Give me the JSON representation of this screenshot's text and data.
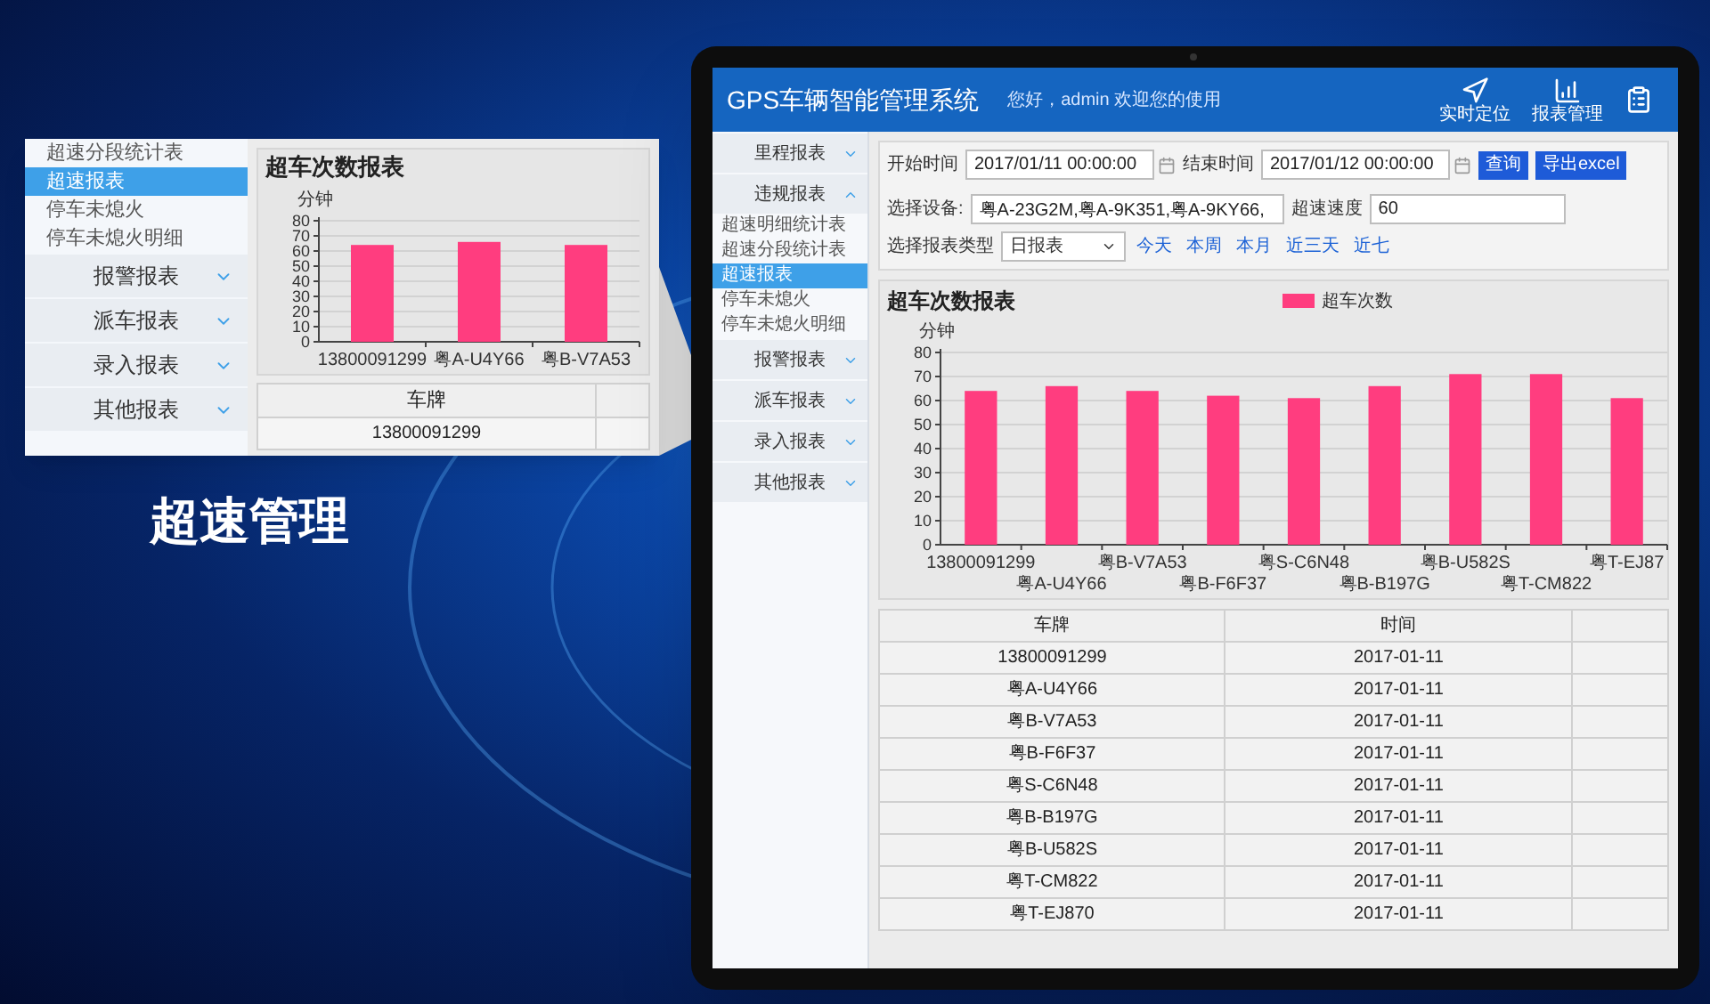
{
  "callout": {
    "sidebar_items": [
      {
        "label": "超速分段统计表",
        "selected": false
      },
      {
        "label": "超速报表",
        "selected": true
      },
      {
        "label": "停车未熄火",
        "selected": false
      },
      {
        "label": "停车未熄火明细",
        "selected": false
      }
    ],
    "sidebar_groups": [
      {
        "label": "报警报表",
        "expanded": false
      },
      {
        "label": "派车报表",
        "expanded": false
      },
      {
        "label": "录入报表",
        "expanded": false
      },
      {
        "label": "其他报表",
        "expanded": false
      }
    ],
    "chart_title": "超车次数报表",
    "chart_data": {
      "type": "bar",
      "grid": true,
      "ylabel": "分钟",
      "categories": [
        "13800091299",
        "粤A-U4Y66",
        "粤B-V7A53"
      ],
      "ylim": [
        0,
        80
      ],
      "yticks": [
        0,
        10,
        20,
        30,
        40,
        50,
        60,
        70,
        80
      ],
      "series": [
        {
          "color": "#ff3d7f",
          "values": [
            64,
            66,
            64
          ]
        }
      ]
    },
    "table": {
      "columns": [
        "车牌"
      ],
      "rows": [
        [
          "13800091299"
        ]
      ]
    }
  },
  "caption": "超速管理",
  "app": {
    "title": "GPS车辆智能管理系统",
    "greeting": "您好，admin 欢迎您的使用",
    "toolbar": [
      {
        "kind": "locate",
        "label": "实时定位"
      },
      {
        "kind": "reports",
        "label": "报表管理"
      },
      {
        "kind": "document"
      }
    ],
    "sidebar": [
      {
        "label": "里程报表",
        "expanded": false
      },
      {
        "label": "违规报表",
        "expanded": true,
        "children": [
          {
            "label": "超速明细统计表",
            "selected": false
          },
          {
            "label": "超速分段统计表",
            "selected": false
          },
          {
            "label": "超速报表",
            "selected": true
          },
          {
            "label": "停车未熄火",
            "selected": false
          },
          {
            "label": "停车未熄火明细",
            "selected": false
          }
        ]
      },
      {
        "label": "报警报表",
        "expanded": false
      },
      {
        "label": "派车报表",
        "expanded": false
      },
      {
        "label": "录入报表",
        "expanded": false
      },
      {
        "label": "其他报表",
        "expanded": false
      }
    ],
    "filters": {
      "start_label": "开始时间",
      "start_value": "2017/01/11 00:00:00",
      "end_label": "结束时间",
      "end_value": "2017/01/12 00:00:00",
      "query_button": "查询",
      "export_button": "导出excel",
      "device_label": "选择设备:",
      "device_value": "粤A-23G2M,粤A-9K351,粤A-9KY66,",
      "speed_label": "超速速度",
      "speed_value": "60",
      "report_type_label": "选择报表类型",
      "report_type_value": "日报表"
    },
    "quick_ranges": [
      "今天",
      "本周",
      "本月",
      "近三天",
      "近七"
    ],
    "chart_title": "超车次数报表",
    "chart_data": {
      "type": "bar",
      "grid": true,
      "ylabel": "分钟",
      "categories": [
        "13800091299",
        "粤A-U4Y66",
        "粤B-V7A53",
        "粤B-F6F37",
        "粤S-C6N48",
        "粤B-B197G",
        "粤B-U582S",
        "粤T-CM822",
        "粤T-EJ87"
      ],
      "ylim": [
        0,
        80
      ],
      "yticks": [
        0,
        10,
        20,
        30,
        40,
        50,
        60,
        70,
        80
      ],
      "series": [
        {
          "name": "超车次数",
          "color": "#ff3d7f",
          "values": [
            64,
            66,
            64,
            62,
            61,
            66,
            71,
            71,
            61
          ]
        }
      ]
    },
    "table": {
      "columns": [
        "车牌",
        "时间"
      ],
      "rows": [
        [
          "13800091299",
          "2017-01-11"
        ],
        [
          "粤A-U4Y66",
          "2017-01-11"
        ],
        [
          "粤B-V7A53",
          "2017-01-11"
        ],
        [
          "粤B-F6F37",
          "2017-01-11"
        ],
        [
          "粤S-C6N48",
          "2017-01-11"
        ],
        [
          "粤B-B197G",
          "2017-01-11"
        ],
        [
          "粤B-U582S",
          "2017-01-11"
        ],
        [
          "粤T-CM822",
          "2017-01-11"
        ],
        [
          "粤T-EJ870",
          "2017-01-11"
        ]
      ]
    }
  }
}
